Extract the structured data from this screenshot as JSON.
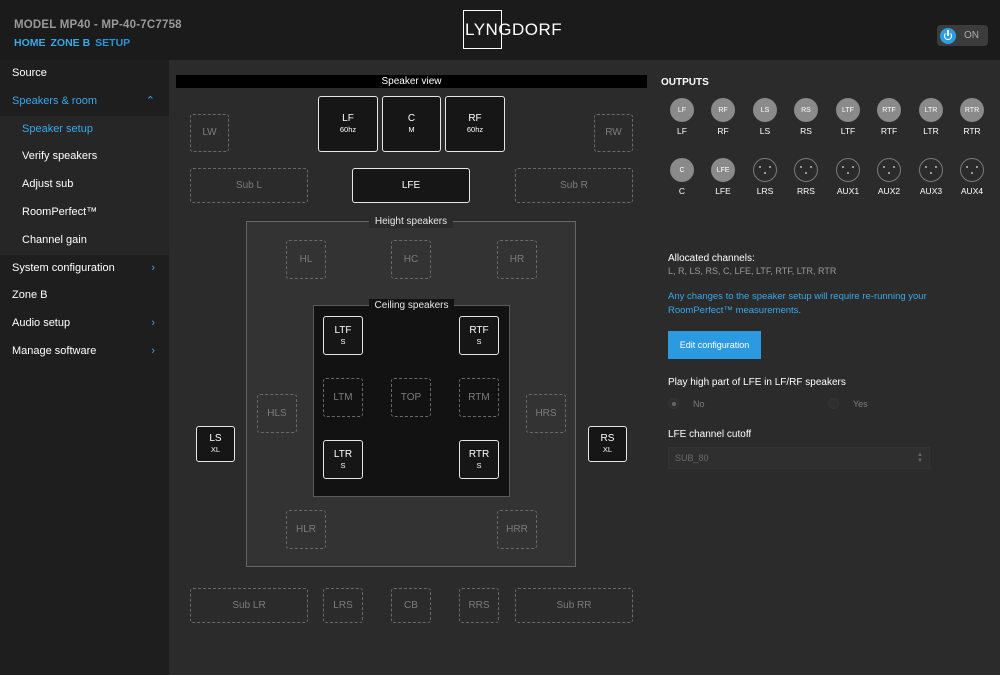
{
  "header": {
    "model": "MODEL MP40 - MP-40-7C7758",
    "crumbs": [
      "HOME",
      "ZONE B",
      "SETUP"
    ],
    "logo": "LYNGDORF",
    "power_label": "ON"
  },
  "sidebar": {
    "source": "Source",
    "speakers_room": "Speakers & room",
    "speaker_setup": "Speaker setup",
    "verify_speakers": "Verify speakers",
    "adjust_sub": "Adjust sub",
    "roomperfect": "RoomPerfect™",
    "channel_gain": "Channel gain",
    "system_configuration": "System configuration",
    "zone_b": "Zone B",
    "audio_setup": "Audio setup",
    "manage_software": "Manage software"
  },
  "speaker_view": {
    "title": "Speaker view",
    "height_label": "Height speakers",
    "ceiling_label": "Ceiling speakers",
    "lf": {
      "name": "LF",
      "size": "60hz"
    },
    "c": {
      "name": "C",
      "size": "M"
    },
    "rf": {
      "name": "RF",
      "size": "60hz"
    },
    "lw": "LW",
    "rw": "RW",
    "sub_l": "Sub L",
    "lfe": "LFE",
    "sub_r": "Sub R",
    "hl": "HL",
    "hc": "HC",
    "hr": "HR",
    "ltf": {
      "name": "LTF",
      "size": "S"
    },
    "rtf": {
      "name": "RTF",
      "size": "S"
    },
    "ltm": "LTM",
    "top": "TOP",
    "rtm": "RTM",
    "hls": "HLS",
    "hrs": "HRS",
    "ls": {
      "name": "LS",
      "size": "XL"
    },
    "rs": {
      "name": "RS",
      "size": "XL"
    },
    "ltr": {
      "name": "LTR",
      "size": "S"
    },
    "rtr": {
      "name": "RTR",
      "size": "S"
    },
    "hlr": "HLR",
    "hrr": "HRR",
    "sub_lr": "Sub LR",
    "lrs": "LRS",
    "cb": "CB",
    "rrs": "RRS",
    "sub_rr": "Sub RR"
  },
  "outputs": {
    "title": "OUTPUTS",
    "row1": [
      {
        "circle": "LF",
        "label": "LF"
      },
      {
        "circle": "RF",
        "label": "RF"
      },
      {
        "circle": "LS",
        "label": "LS"
      },
      {
        "circle": "RS",
        "label": "RS"
      },
      {
        "circle": "LTF",
        "label": "LTF"
      },
      {
        "circle": "RTF",
        "label": "RTF"
      },
      {
        "circle": "LTR",
        "label": "LTR"
      },
      {
        "circle": "RTR",
        "label": "RTR"
      }
    ],
    "row2": [
      {
        "circle": "C",
        "label": "C"
      },
      {
        "circle": "LFE",
        "label": "LFE"
      },
      {
        "circle": "",
        "label": "LRS"
      },
      {
        "circle": "",
        "label": "RRS"
      },
      {
        "circle": "",
        "label": "AUX1"
      },
      {
        "circle": "",
        "label": "AUX2"
      },
      {
        "circle": "",
        "label": "AUX3"
      },
      {
        "circle": "",
        "label": "AUX4"
      }
    ]
  },
  "allocated": {
    "title": "Allocated channels:",
    "list": "L, R, LS, RS, C, LFE, LTF, RTF, LTR, RTR"
  },
  "notice": "Any changes to the speaker setup will require re-running your RoomPerfect™ measurements.",
  "edit_button": "Edit configuration",
  "play_high": {
    "label": "Play high part of LFE in LF/RF speakers",
    "no": "No",
    "yes": "Yes",
    "selected": "No"
  },
  "lfe_cutoff": {
    "label": "LFE channel cutoff",
    "value": "SUB_80"
  }
}
